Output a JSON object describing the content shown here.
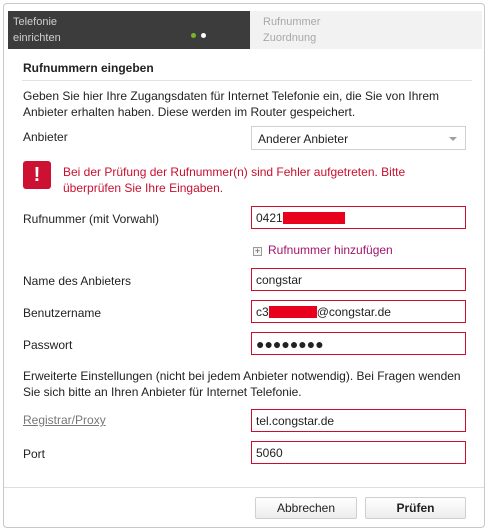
{
  "wizard": {
    "step1": {
      "line1": "Telefonie",
      "line2": "einrichten"
    },
    "step2": {
      "line1": "Rufnummer",
      "line2": "Zuordnung"
    }
  },
  "section_title": "Rufnummern eingeben",
  "intro": "Geben Sie hier Ihre Zugangsdaten für Internet Telefonie ein, die Sie von Ihrem Anbieter erhalten haben. Diese werden im Router gespeichert.",
  "provider": {
    "label": "Anbieter",
    "value": "Anderer Anbieter"
  },
  "error": {
    "icon": "exclamation-icon",
    "message": "Bei der Prüfung der Rufnummer(n) sind Fehler aufgetreten. Bitte überprüfen Sie Ihre Eingaben."
  },
  "phone": {
    "label": "Rufnummer (mit Vorwahl)",
    "value": "0421"
  },
  "add_number": {
    "icon": "plus-box-icon",
    "label": "Rufnummer hinzufügen"
  },
  "provider_name": {
    "label": "Name des Anbieters",
    "value": "congstar"
  },
  "username": {
    "label": "Benutzername",
    "prefix": "c3",
    "suffix": "@congstar.de"
  },
  "password": {
    "label": "Passwort",
    "value": "●●●●●●●●"
  },
  "advanced_note": "Erweiterte Einstellungen (nicht bei jedem Anbieter notwendig). Bei Fragen wenden Sie sich bitte an Ihren Anbieter für Internet Telefonie.",
  "registrar": {
    "label": "Registrar/Proxy",
    "value": "tel.congstar.de"
  },
  "port": {
    "label": "Port",
    "value": "5060"
  },
  "buttons": {
    "cancel": "Abbrechen",
    "check": "Prüfen"
  },
  "colors": {
    "error": "#c8102e",
    "accent_link": "#a0156c",
    "redaction": "#e8001c"
  }
}
